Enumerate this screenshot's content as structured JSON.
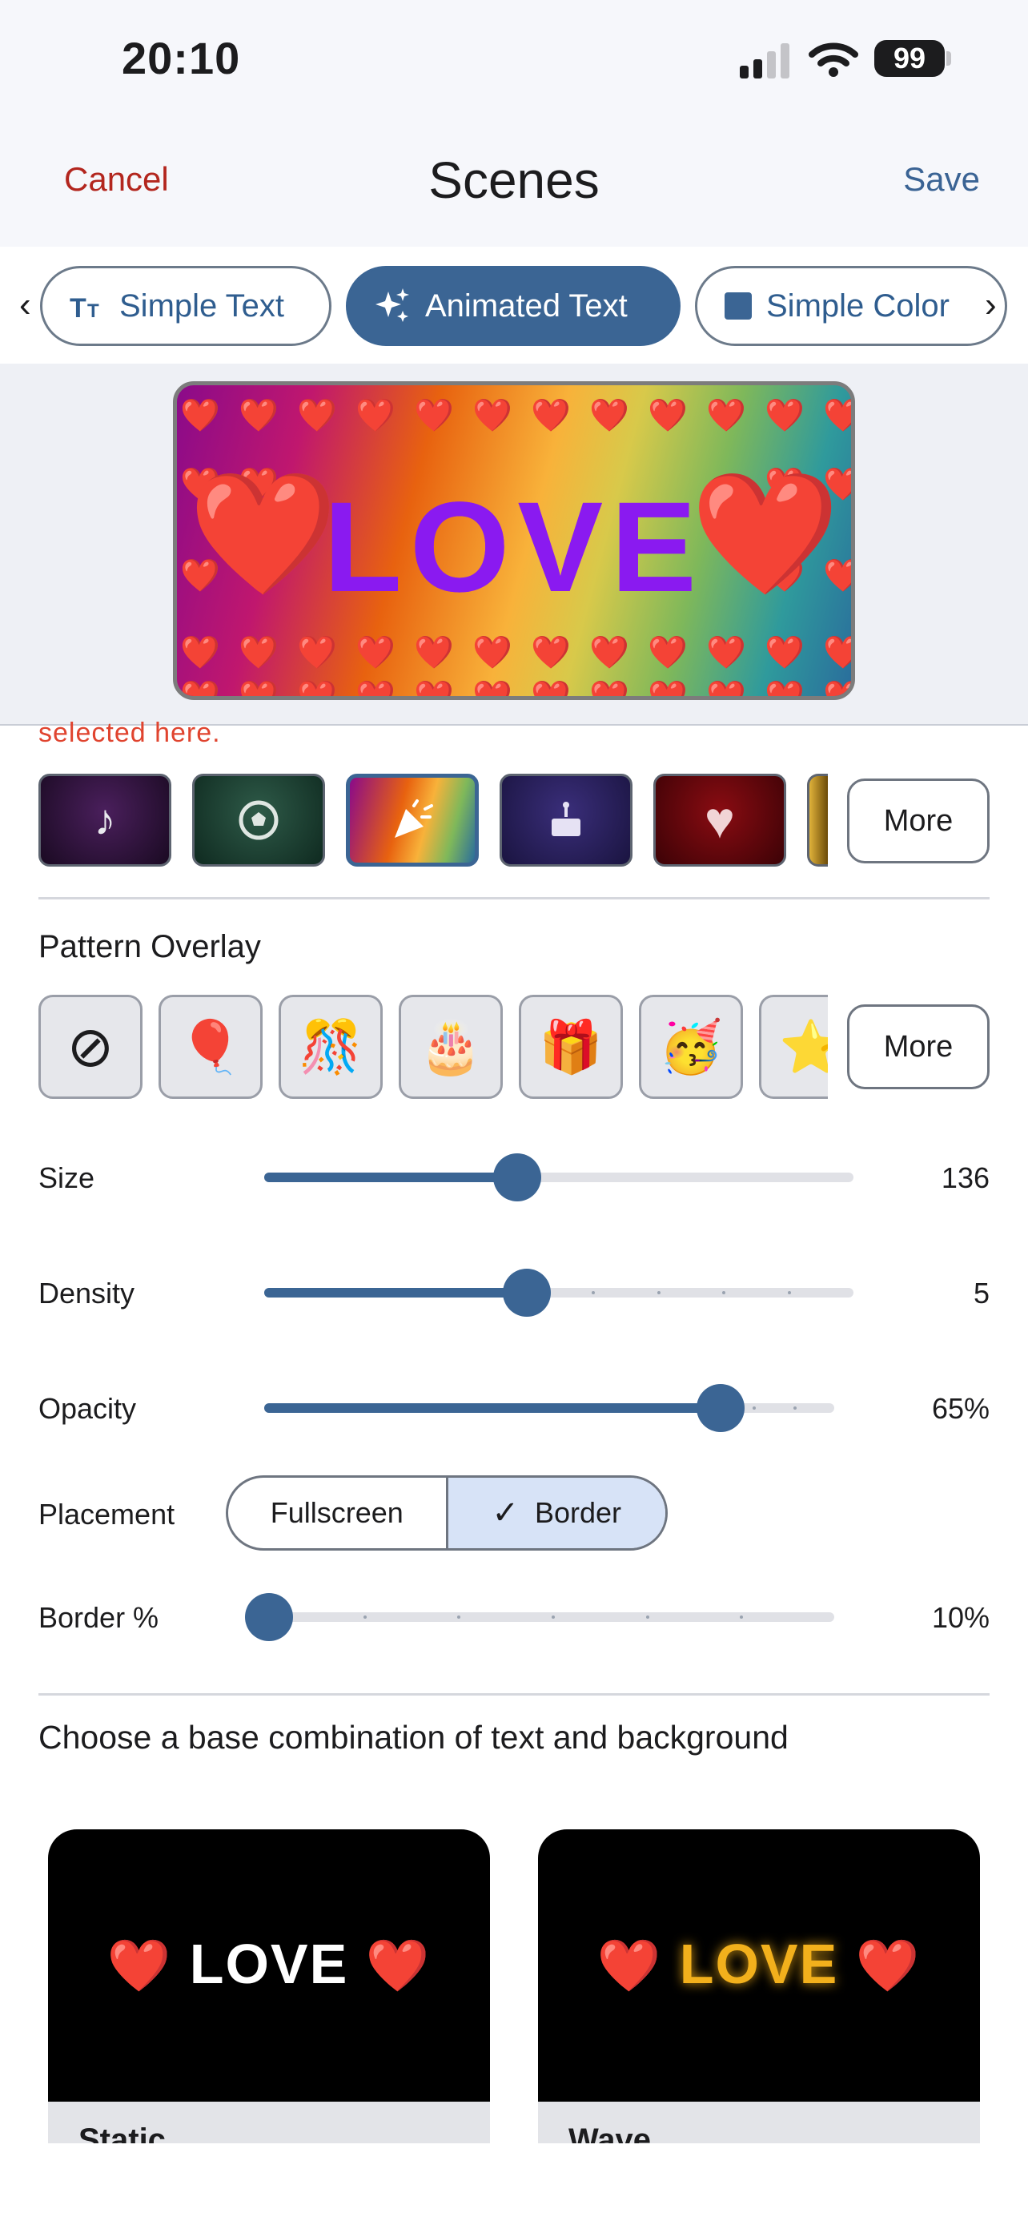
{
  "status": {
    "time": "20:10",
    "battery": "99"
  },
  "nav": {
    "cancel": "Cancel",
    "title": "Scenes",
    "save": "Save"
  },
  "tabs": [
    {
      "label": "Simple Text",
      "icon": "text-size-icon",
      "active": false
    },
    {
      "label": "Animated Text",
      "icon": "sparkles-icon",
      "active": true
    },
    {
      "label": "Simple Color",
      "icon": "square-icon",
      "active": false
    }
  ],
  "preview": {
    "text": "LOVE",
    "emoji": "❤️"
  },
  "hint": "selected here.",
  "colors": {
    "swatches": [
      {
        "icon": "music-note-icon",
        "glyph": "♪"
      },
      {
        "icon": "soccer-ball-icon",
        "glyph": "⚽"
      },
      {
        "icon": "party-popper-icon",
        "glyph": "🎉",
        "selected": true
      },
      {
        "icon": "cake-icon",
        "glyph": "🎂"
      },
      {
        "icon": "heart-icon",
        "glyph": "♥"
      }
    ],
    "more": "More"
  },
  "pattern": {
    "title": "Pattern Overlay",
    "items": [
      "⊘",
      "🎈",
      "🎊",
      "🎂",
      "🎁",
      "🥳",
      "⭐"
    ],
    "more": "More"
  },
  "sliders": {
    "size": {
      "label": "Size",
      "value": "136",
      "fraction": 0.43
    },
    "density": {
      "label": "Density",
      "value": "5",
      "fraction": 0.445
    },
    "opacity": {
      "label": "Opacity",
      "value": "65%",
      "fraction": 0.8
    }
  },
  "placement": {
    "label": "Placement",
    "options": [
      "Fullscreen",
      "Border"
    ],
    "selected": "Border",
    "check": "✓"
  },
  "border": {
    "label": "Border %",
    "value": "10%",
    "fraction": 0.0
  },
  "choose": {
    "title": "Choose a base combination of text and background",
    "cards": [
      {
        "text": "LOVE",
        "caption": "Static"
      },
      {
        "text": "LOVE",
        "caption": "Wave"
      }
    ]
  },
  "accent": "#3b6594"
}
